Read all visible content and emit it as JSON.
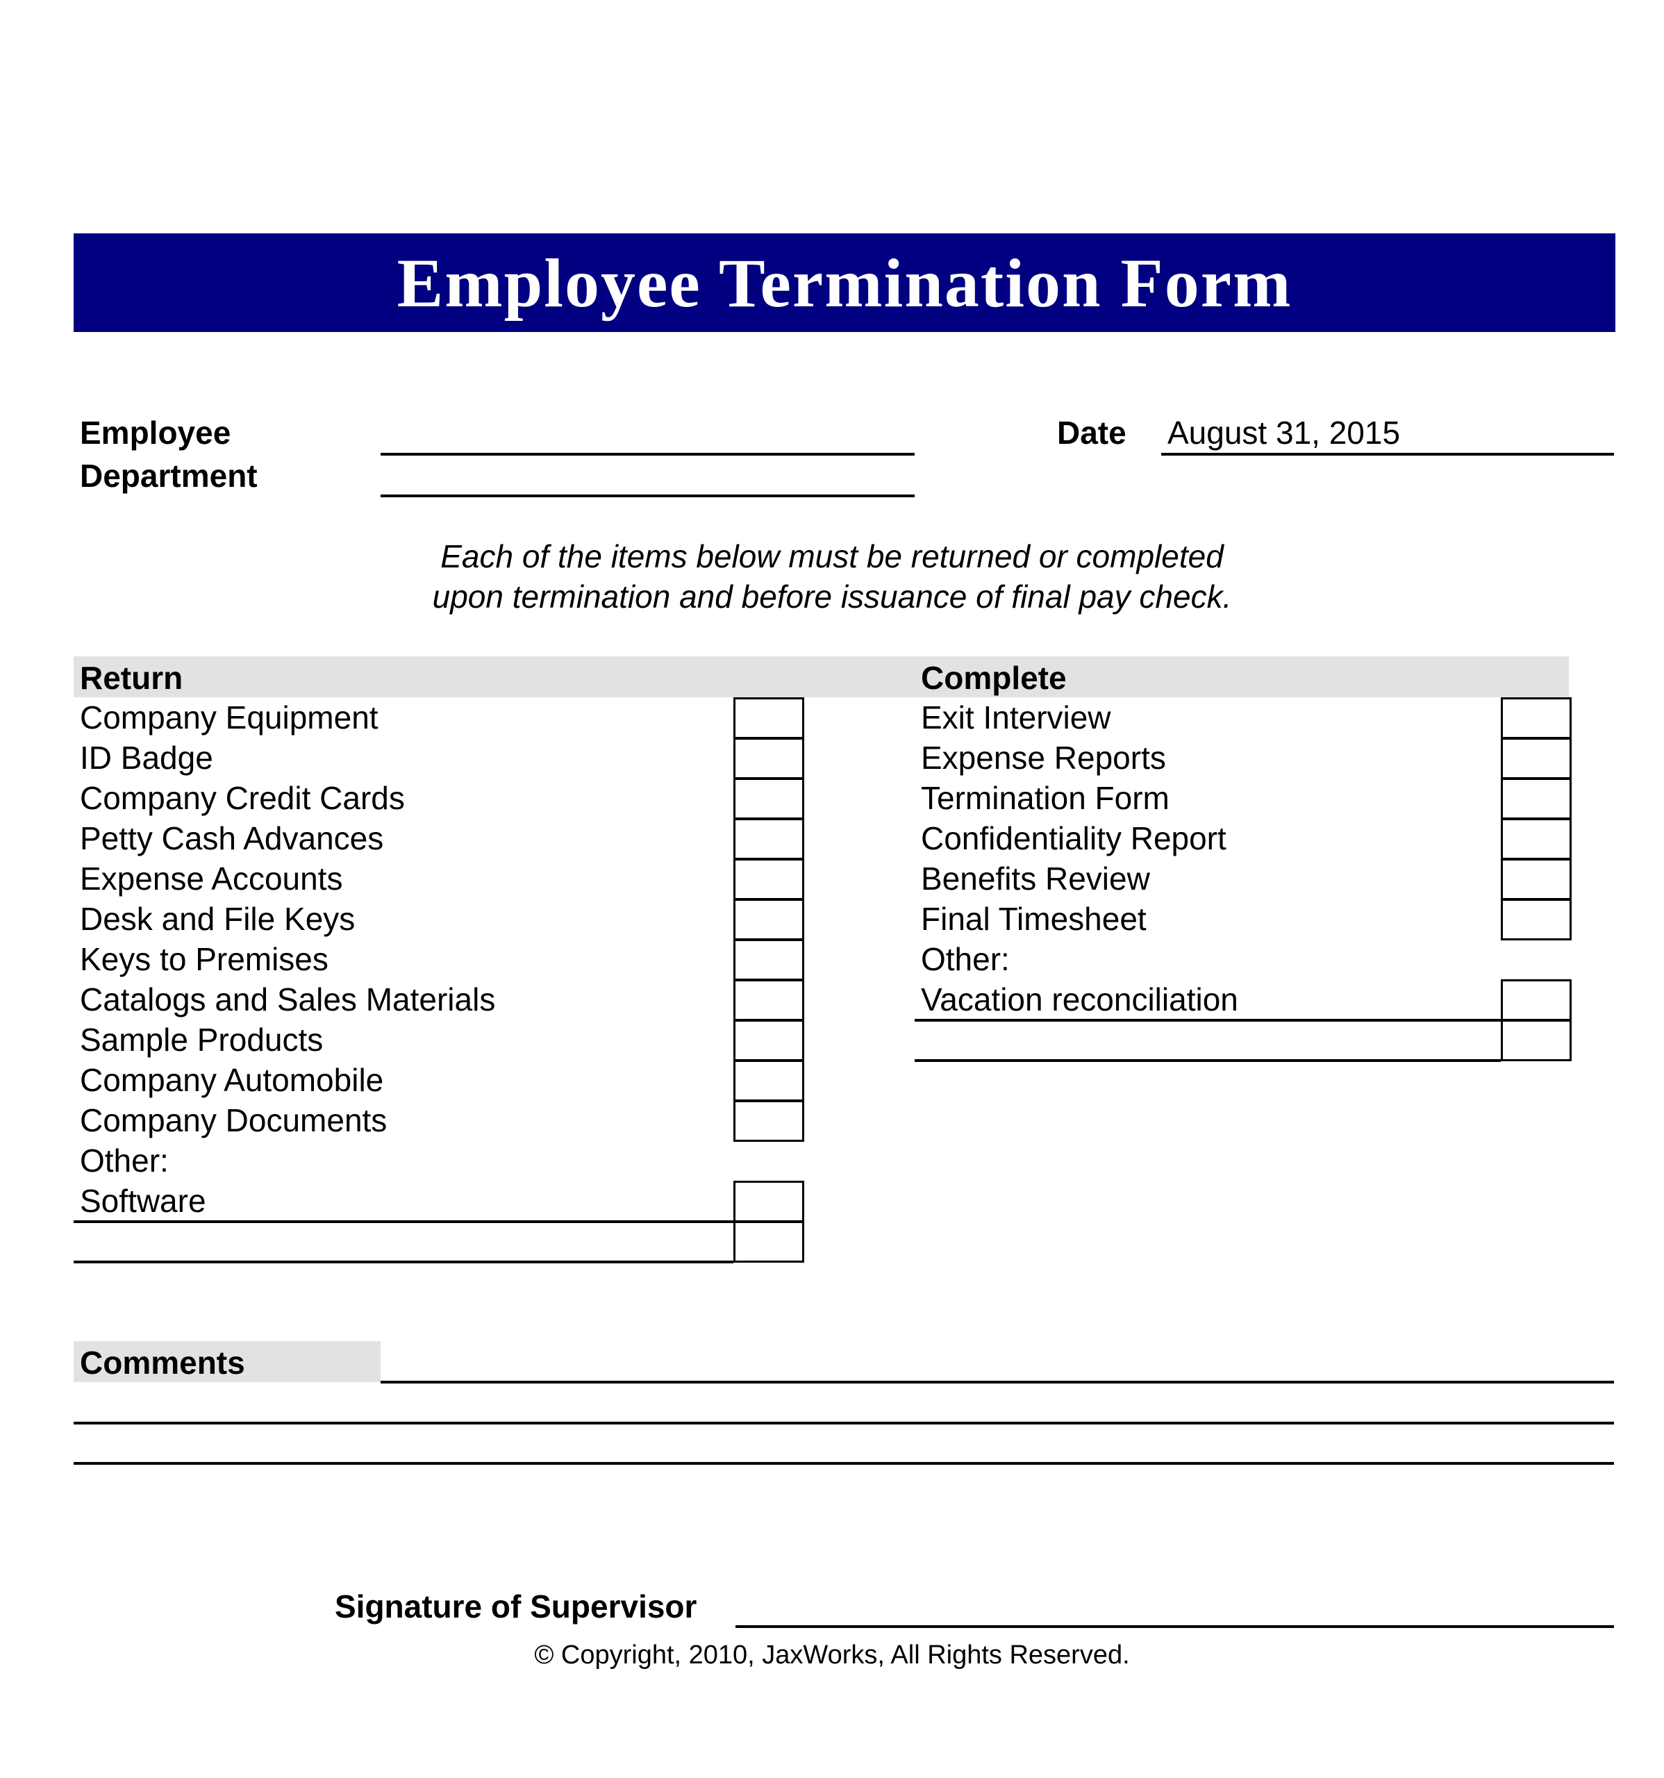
{
  "title": "Employee Termination Form",
  "header_fields": {
    "employee_label": "Employee",
    "employee_value": "",
    "department_label": "Department",
    "department_value": "",
    "date_label": "Date",
    "date_value": "August 31, 2015"
  },
  "instructions": [
    "Each of the items below must be returned or completed",
    "upon termination and before issuance of final pay check."
  ],
  "return_section": {
    "heading": "Return",
    "items": [
      "Company Equipment",
      "ID Badge",
      "Company Credit Cards",
      "Petty Cash Advances",
      "Expense Accounts",
      "Desk and File Keys",
      "Keys to Premises",
      "Catalogs and Sales Materials",
      "Sample Products",
      "Company Automobile",
      "Company Documents"
    ],
    "other_label": "Other:",
    "other_items": [
      "Software",
      ""
    ]
  },
  "complete_section": {
    "heading": "Complete",
    "items": [
      "Exit Interview",
      "Expense Reports",
      "Termination Form",
      "Confidentiality Report",
      "Benefits Review",
      "Final Timesheet"
    ],
    "other_label": "Other:",
    "other_items": [
      "Vacation reconciliation",
      ""
    ]
  },
  "comments": {
    "label": "Comments",
    "lines": [
      "",
      "",
      ""
    ]
  },
  "signature": {
    "label": "Signature of Supervisor",
    "value": ""
  },
  "footer": {
    "copyright": "© Copyright, 2010, JaxWorks, All Rights Reserved."
  },
  "colors": {
    "banner": "#000080",
    "section_band": "#e2e2e2"
  }
}
